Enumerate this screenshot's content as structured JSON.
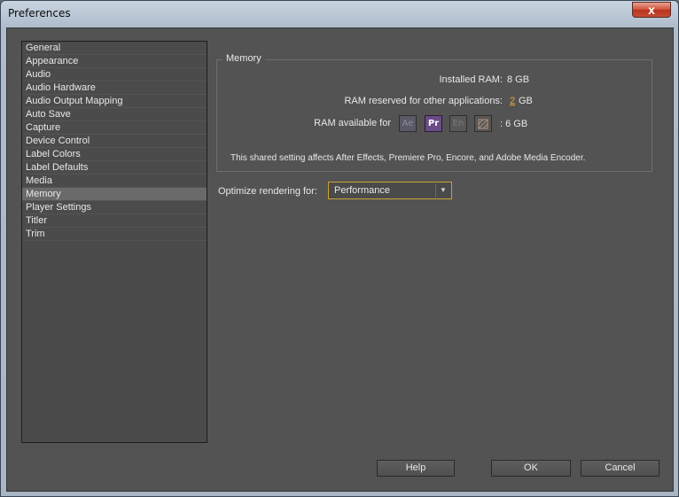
{
  "window": {
    "title": "Preferences",
    "close_glyph": "x"
  },
  "sidebar": {
    "items": [
      {
        "label": "General"
      },
      {
        "label": "Appearance"
      },
      {
        "label": "Audio"
      },
      {
        "label": "Audio Hardware"
      },
      {
        "label": "Audio Output Mapping"
      },
      {
        "label": "Auto Save"
      },
      {
        "label": "Capture"
      },
      {
        "label": "Device Control"
      },
      {
        "label": "Label Colors"
      },
      {
        "label": "Label Defaults"
      },
      {
        "label": "Media"
      },
      {
        "label": "Memory"
      },
      {
        "label": "Player Settings"
      },
      {
        "label": "Titler"
      },
      {
        "label": "Trim"
      }
    ],
    "selected": "Memory"
  },
  "memory": {
    "group_label": "Memory",
    "installed_ram_label": "Installed RAM:",
    "installed_ram_value": "8 GB",
    "reserved_label": "RAM reserved for other applications:",
    "reserved_value": "2",
    "reserved_unit": "GB",
    "available_label": "RAM available for",
    "available_value": ": 6 GB",
    "apps": [
      {
        "name": "after-effects",
        "abbr": "Ae",
        "active": false
      },
      {
        "name": "premiere-pro",
        "abbr": "Pr",
        "active": true
      },
      {
        "name": "encore",
        "abbr": "En",
        "active": false
      },
      {
        "name": "media-encoder",
        "abbr": "",
        "active": false
      }
    ],
    "note": "This shared setting affects After Effects, Premiere Pro, Encore, and Adobe Media Encoder."
  },
  "optimize": {
    "label": "Optimize rendering for:",
    "selected": "Performance"
  },
  "buttons": {
    "help": "Help",
    "ok": "OK",
    "cancel": "Cancel"
  },
  "colors": {
    "panel_bg": "#535353",
    "accent": "#c9a233",
    "editable_value": "#e8a53b",
    "premiere_icon": "#6b4a86"
  }
}
